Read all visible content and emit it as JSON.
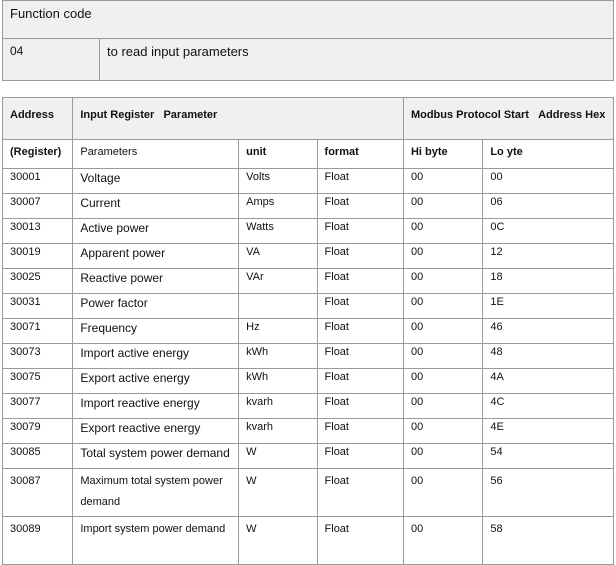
{
  "function_table": {
    "header": "Function code",
    "code": "04",
    "description": "to read input parameters"
  },
  "register_table": {
    "header": {
      "address": "Address",
      "input_register": "Input Register",
      "parameter": "Parameter",
      "modbus": "Modbus Protocol Start",
      "address_hex": "Address Hex"
    },
    "subheader": {
      "register": "(Register)",
      "parameters": "Parameters",
      "unit": "unit",
      "format": "format",
      "hi": "Hi byte",
      "lo": "Lo yte"
    },
    "rows": [
      {
        "address": "30001",
        "parameter": "Voltage",
        "unit": "Volts",
        "format": "Float",
        "hi": "00",
        "lo": "00"
      },
      {
        "address": "30007",
        "parameter": "Current",
        "unit": "Amps",
        "format": "Float",
        "hi": "00",
        "lo": "06"
      },
      {
        "address": "30013",
        "parameter": "Active power",
        "unit": "Watts",
        "format": "Float",
        "hi": "00",
        "lo": "0C"
      },
      {
        "address": "30019",
        "parameter": "Apparent power",
        "unit": "VA",
        "format": "Float",
        "hi": "00",
        "lo": "12"
      },
      {
        "address": "30025",
        "parameter": "Reactive power",
        "unit": "VAr",
        "format": "Float",
        "hi": "00",
        "lo": "18"
      },
      {
        "address": "30031",
        "parameter": "Power factor",
        "unit": "",
        "format": "Float",
        "hi": "00",
        "lo": "1E"
      },
      {
        "address": "30071",
        "parameter": "Frequency",
        "unit": "Hz",
        "format": "Float",
        "hi": "00",
        "lo": "46"
      },
      {
        "address": "30073",
        "parameter": "Import active energy",
        "unit": "kWh",
        "format": "Float",
        "hi": "00",
        "lo": "48"
      },
      {
        "address": "30075",
        "parameter": "Export active energy",
        "unit": "kWh",
        "format": "Float",
        "hi": "00",
        "lo": "4A"
      },
      {
        "address": "30077",
        "parameter": "Import reactive energy",
        "unit": "kvarh",
        "format": "Float",
        "hi": "00",
        "lo": "4C"
      },
      {
        "address": "30079",
        "parameter": "Export reactive energy",
        "unit": "kvarh",
        "format": "Float",
        "hi": "00",
        "lo": "4E"
      },
      {
        "address": "30085",
        "parameter": "Total system power demand",
        "unit": "W",
        "format": "Float",
        "hi": "00",
        "lo": "54"
      },
      {
        "address": "30087",
        "parameter": "Maximum total system power demand",
        "unit": "W",
        "format": "Float",
        "hi": "00",
        "lo": "56"
      },
      {
        "address": "30089",
        "parameter": "Import system power demand",
        "unit": "W",
        "format": "Float",
        "hi": "00",
        "lo": "58"
      }
    ]
  }
}
